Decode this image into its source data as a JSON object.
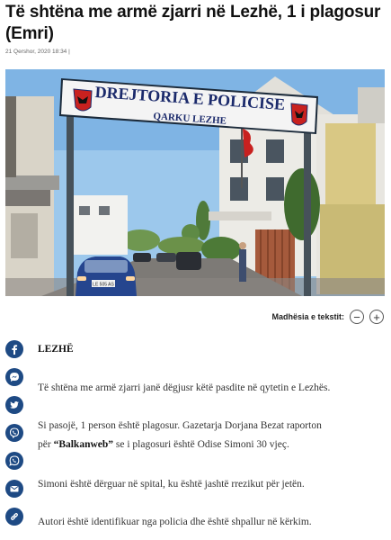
{
  "article": {
    "title": "Të shtëna me armë zjarri në Lezhë, 1 i plagosur (Emri)",
    "meta": "21 Qershor, 2020 18:34 |",
    "dateline": "LEZHË",
    "paragraphs": [
      "Të shtëna me armë zjarri janë dëgjusr këtë pasdite në qytetin e Lezhës.",
      "Simoni është dërguar në spital, ku është jashtë rrezikut për jetën.",
      "Autori është identifikuar nga policia dhe është shpallur në kërkim."
    ],
    "p2": {
      "line1": "Si pasojë, 1 person është plagosur. Gazetarja Dorjana Bezat raporton",
      "pre": "për ",
      "outlet": "“Balkanweb”",
      "post": " se i plagosuri është Odise Simoni 30 vjeç."
    }
  },
  "photo": {
    "sign_line1": "DREJTORIA E POLICISE",
    "sign_line2": "QARKU LEZHE",
    "plate": "LE 505 AS"
  },
  "font_control": {
    "label": "Madhësia e tekstit:",
    "decrease": "−",
    "increase": "+"
  },
  "share": [
    "facebook-icon",
    "messenger-icon",
    "twitter-icon",
    "viber-icon",
    "whatsapp-icon",
    "email-icon",
    "link-icon"
  ],
  "colors": {
    "share_bg": "#1e4a84",
    "sky": "#9cc8ec",
    "sign_bg": "#f4f4f4",
    "sign_text": "#1b2a6b",
    "emblem_red": "#c8211f"
  }
}
